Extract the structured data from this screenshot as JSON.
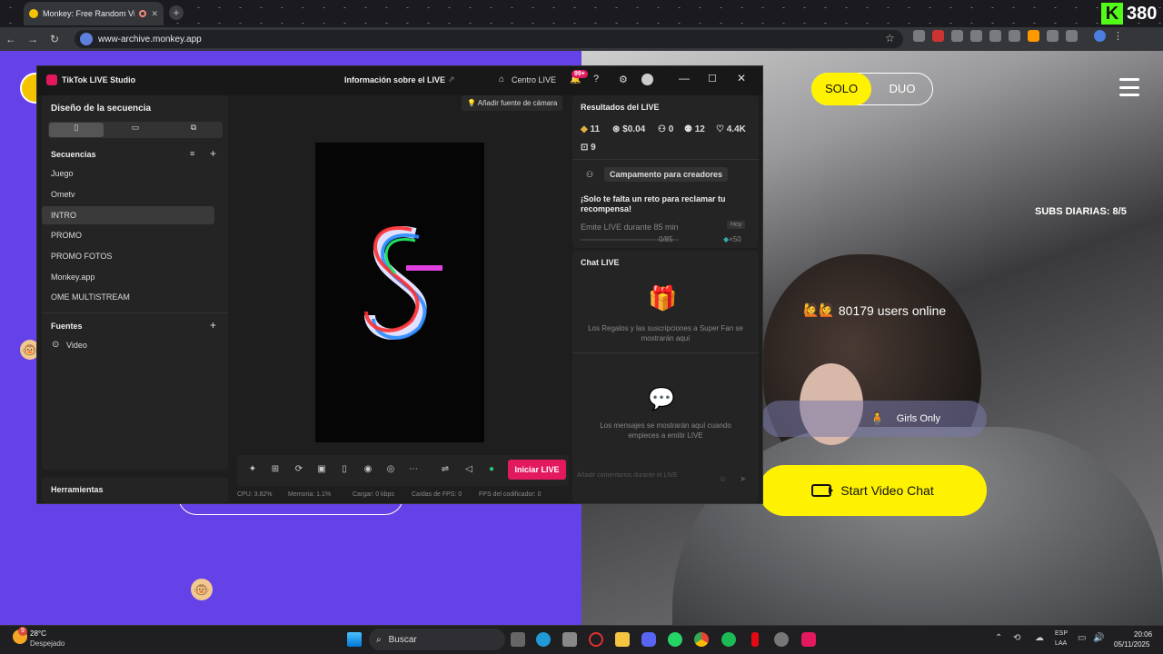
{
  "browser": {
    "tab_title": "Monkey: Free Random Vid",
    "url": "www-archive.monkey.app",
    "kick_count": "380",
    "kick_logo": "K"
  },
  "page": {
    "solo": "SOLO",
    "duo": "DUO",
    "subs": "SUBS DIARIAS: 8/5",
    "online": "80179 users online",
    "online_emoji": "🙋🙋",
    "girls_only": "Girls Only",
    "girls_icon": "🧍",
    "start_video": "Start Video Chat",
    "monkey_emoji": "🐵"
  },
  "tiktok": {
    "app_title": "TikTok LIVE Studio",
    "info": "Información sobre el LIVE",
    "centro": "Centro LIVE",
    "badge": "99+",
    "layout_title": "Diseño de la secuencia",
    "sequences_title": "Secuencias",
    "sequences": [
      "Juego",
      "Ometv",
      "INTRO",
      "PROMO",
      "PROMO FOTOS",
      "Monkey.app",
      "OME MULTISTREAM"
    ],
    "sources_title": "Fuentes",
    "source_video": "Video",
    "tools_title": "Herramientas",
    "add_camera": "Añadir fuente de cámara",
    "start_live": "Iniciar LIVE",
    "results_title": "Resultados del LIVE",
    "stats": {
      "diamonds": "11",
      "money": "$0.04",
      "viewers": "0",
      "followers": "12",
      "likes": "4.4K",
      "gifts": "9"
    },
    "campaign": "Campamento para creadores",
    "challenge": "¡Solo te falta un reto para reclamar tu recompensa!",
    "challenge_task": "Emite LIVE durante 85 min",
    "challenge_day": "Hoy",
    "challenge_progress": "0/85",
    "challenge_reward": "×50",
    "chat_title": "Chat LIVE",
    "chat_gifts_msg": "Los Regalos y las suscripciones a Super Fan se mostrarán aquí",
    "chat_msgs_msg": "Los mensajes se mostrarán aquí cuando empieces a emitir LIVE",
    "chat_placeholder": "Añadir comentarios durante el LIVE",
    "status": {
      "cpu": "CPU: 3.82%",
      "mem": "Memoria: 1.1%",
      "load": "Cargar: 0 kbps",
      "fps": "Caídas de FPS: 0",
      "enc": "FPS del codificador: 0"
    }
  },
  "taskbar": {
    "temp": "28°C",
    "weather": "Despejado",
    "search": "Buscar",
    "lang1": "ESP",
    "lang2": "LAA",
    "time": "20:06",
    "date": "05/11/2025",
    "weather_badge": "9"
  }
}
